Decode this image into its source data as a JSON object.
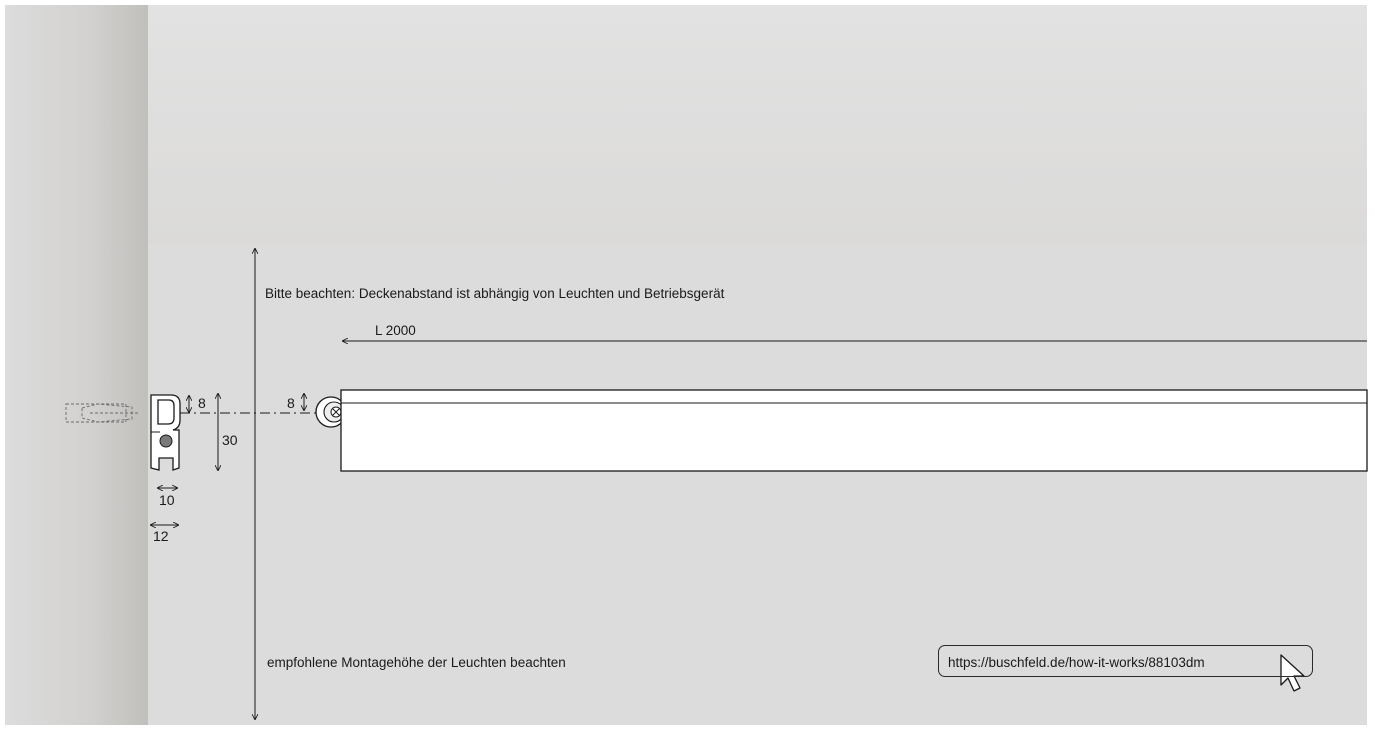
{
  "notes": {
    "ceiling_distance": "Bitte beachten: Deckenabstand ist abhängig von Leuchten und Betriebsgerät",
    "mounting_height": "empfohlene Montagehöhe der Leuchten beachten"
  },
  "dimensions": {
    "length": "L 2000",
    "profile_offset": "8",
    "profile_height": "30",
    "rail_offset": "8",
    "profile_inner_width": "10",
    "profile_outer_width": "12"
  },
  "link": {
    "url": "https://buschfeld.de/how-it-works/88103dm"
  },
  "colors": {
    "background": "#dcdcdc",
    "shadow": "#c4c3c1",
    "line": "#1a1a1a",
    "rail_fill": "#ffffff"
  },
  "icons": {
    "cursor": "mouse-pointer-icon",
    "anchor": "wall-anchor-icon",
    "end_cap": "screw-end-cap-icon"
  }
}
